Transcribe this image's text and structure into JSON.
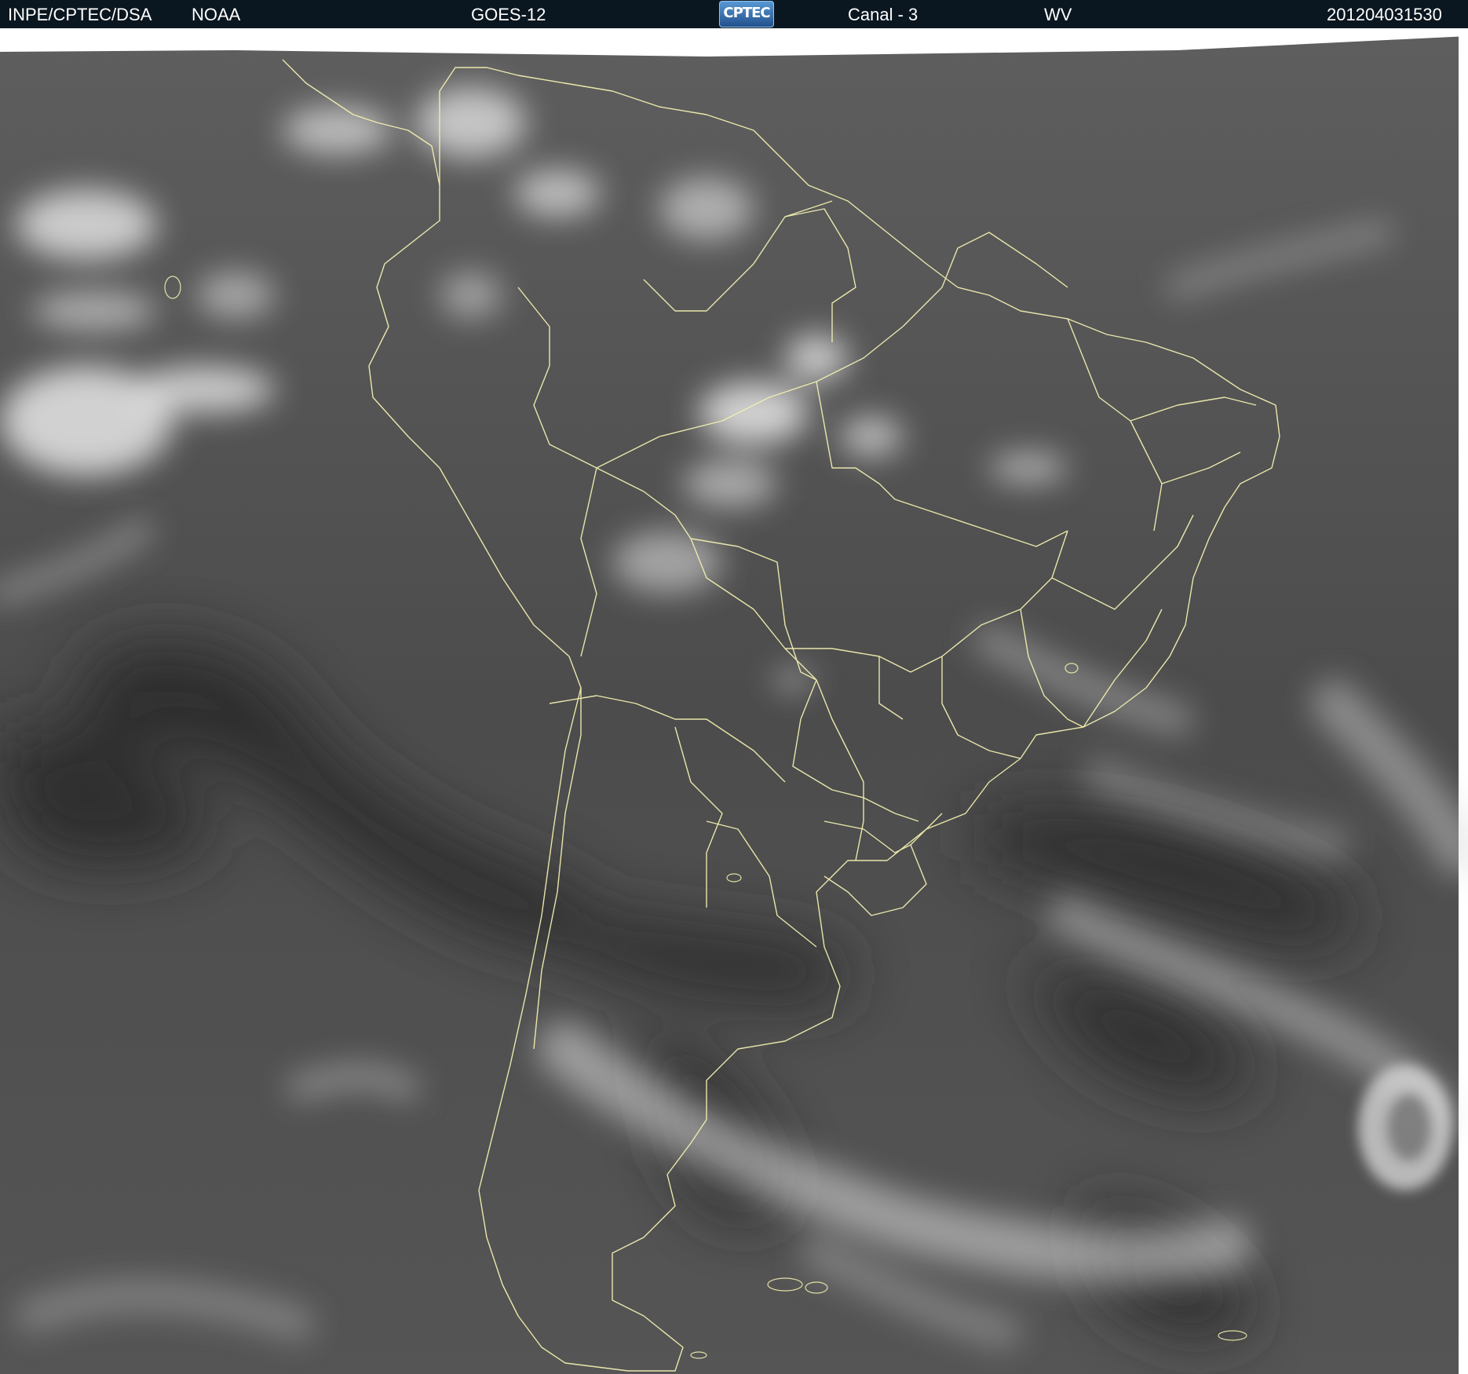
{
  "header": {
    "agency": "INPE/CPTEC/DSA",
    "source": "NOAA",
    "satellite": "GOES-12",
    "logo_text": "CPTEC",
    "channel": "Canal - 3",
    "band": "WV",
    "timestamp": "201204031530"
  },
  "map": {
    "region": "South America",
    "overlay": "political boundaries",
    "border_color": "#f2efb0",
    "background_color": "#555555",
    "cloud_color": "#f2f2f2",
    "dry_air_color": "#262626"
  }
}
